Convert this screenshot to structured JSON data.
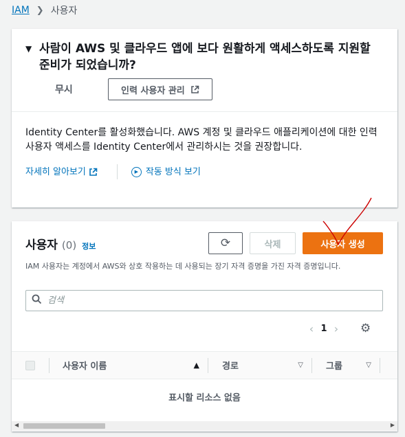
{
  "breadcrumb": {
    "root": "IAM",
    "current": "사용자"
  },
  "identity_center": {
    "title": "사람이 AWS 및 클라우드 앱에 보다 원활하게 액세스하도록 지원할 준비가 되었습니까?",
    "dismiss_label": "무시",
    "manage_label": "인력 사용자 관리",
    "body": "Identity Center를 활성화했습니다. AWS 계정 및 클라우드 애플리케이션에 대한 인력 사용자 액세스를 Identity Center에서 관리하시는 것을 권장합니다.",
    "learn_more": "자세히 알아보기",
    "how_it_works": "작동 방식 보기"
  },
  "users": {
    "title": "사용자",
    "count": "(0)",
    "info": "정보",
    "delete_label": "삭제",
    "create_label": "사용자 생성",
    "description": "IAM 사용자는 계정에서 AWS와 상호 작용하는 데 사용되는 장기 자격 증명을 가진 자격 증명입니다.",
    "search_placeholder": "검색",
    "page": "1",
    "columns": [
      "사용자 이름",
      "경로",
      "그룹"
    ],
    "empty_text": "표시할 리소스 없음"
  },
  "colors": {
    "primary_button": "#ec7211",
    "link": "#0073bb",
    "annotation": "#cc0000"
  },
  "icons": [
    "chevron-right-icon",
    "caret-down-icon",
    "external-link-icon",
    "play-icon",
    "refresh-icon",
    "search-icon",
    "chevron-left-icon",
    "gear-icon",
    "sort-icon"
  ]
}
